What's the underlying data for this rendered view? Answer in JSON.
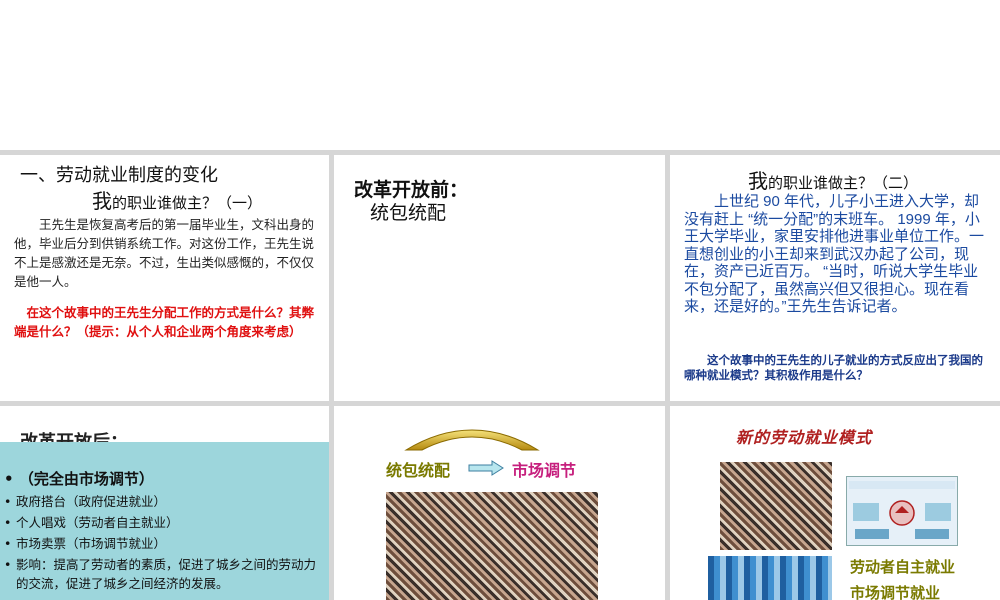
{
  "slide1": {
    "title": "一、劳动就业制度的变化",
    "sub_big": "我",
    "sub_rest": "的职业谁做主？（一）",
    "body": "王先生是恢复高考后的第一届毕业生，文科出身的他，毕业后分到供销系统工作。对这份工作，王先生说不上是感激还是无奈。不过，生出类似感慨的，不仅仅是他一人。",
    "question": "在这个故事中的王先生分配工作的方式是什么？其弊端是什么？（提示：从个人和企业两个角度来考虑）"
  },
  "slide2": {
    "heading": "改革开放前：",
    "line2": "统包统配"
  },
  "slide3": {
    "sub_big": "我",
    "sub_rest": "的职业谁做主？（二）",
    "body": "上世纪 90 年代，儿子小王进入大学，却没有赶上 “统一分配”的末班车。 1999 年，小王大学毕业，家里安排他进事业单位工作。一直想创业的小王却来到武汉办起了公司，现在，资产已近百万。 “当时，听说大学生毕业不包分配了，虽然高兴但又很担心。现在看来，还是好的。”王先生告诉记者。",
    "question": "这个故事中的王先生的儿子就业的方式反应出了我国的哪种就业模式？其积极作用是什么？"
  },
  "slide4": {
    "heading": "改革开放后：",
    "box_heading": "（完全由市场调节）",
    "items": [
      "政府搭台（政府促进就业）",
      "个人唱戏（劳动者自主就业）",
      "市场卖票（市场调节就业）",
      "影响：提高了劳动者的素质，促进了城乡之间的劳动力的交流，促进了城乡之间经济的发展。"
    ]
  },
  "slide5": {
    "from": "统包统配",
    "to": "市场调节"
  },
  "slide6": {
    "title": "新的劳动就业模式",
    "line1": "劳动者自主就业",
    "line2": "市场调节就业"
  },
  "colors": {
    "question_red": "#e01010",
    "body_blue": "#1b4aa0",
    "box_teal": "#9dd6dc",
    "olive": "#7a7a00",
    "magenta": "#c61f7d"
  }
}
